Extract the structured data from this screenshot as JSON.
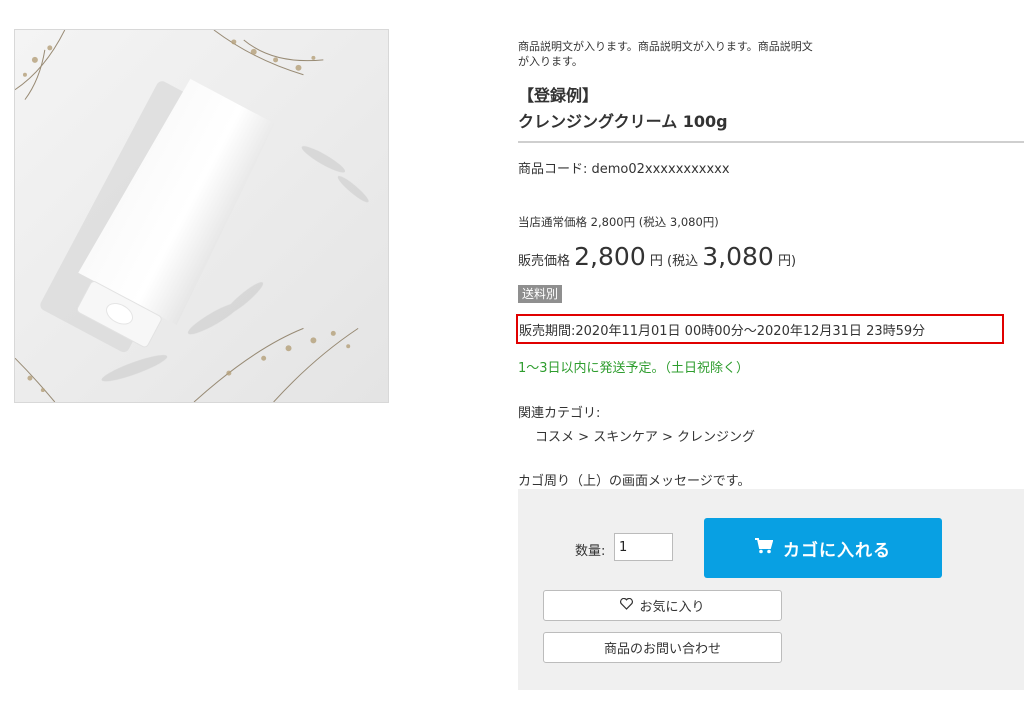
{
  "product": {
    "description": "商品説明文が入ります。商品説明文が入ります。商品説明文が入ります。",
    "title_line1": "【登録例】",
    "title_line2": "クレンジングクリーム 100g",
    "code": "商品コード: demo02xxxxxxxxxxx",
    "normal_price": "当店通常価格 2,800円 (税込 3,080円)",
    "sale_price": {
      "label": "販売価格",
      "price": "2,800",
      "yen": "円",
      "tax_label": "(税込",
      "tax_price": "3,080",
      "tax_yen": "円)"
    },
    "shipping_badge": "送料別",
    "sale_period": "販売期間:2020年11月01日 00時00分〜2020年12月31日 23時59分",
    "delivery": "1〜3日以内に発送予定。（土日祝除く）",
    "category_label": "関連カテゴリ:",
    "category_path": [
      "コスメ",
      ">",
      "スキンケア",
      ">",
      "クレンジング"
    ],
    "cart_message": "カゴ周り（上）の画面メッセージです。"
  },
  "cart": {
    "qty_label": "数量:",
    "qty_value": "1",
    "add_to_cart": "カゴに入れる",
    "favorite": "お気に入り",
    "inquiry": "商品のお問い合わせ"
  },
  "icons": {
    "cart": "cart-icon",
    "favorite": "heart-icon"
  },
  "colors": {
    "cart_button": "#08a0e3",
    "highlight_border": "#e00000",
    "delivery_text": "#2e9d2e",
    "badge_bg": "#8f8f8f"
  }
}
